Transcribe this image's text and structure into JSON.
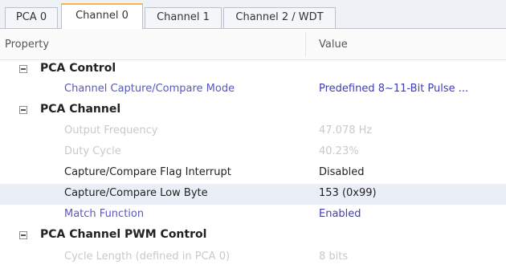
{
  "tabs": [
    "PCA 0",
    "Channel 0",
    "Channel 1",
    "Channel 2 / WDT"
  ],
  "active_tab": "Channel 0",
  "grid": {
    "headers": {
      "property": "Property",
      "value": "Value"
    },
    "categories": [
      {
        "name": "PCA Control",
        "rows": [
          {
            "property": "Channel Capture/Compare Mode",
            "value": "Predefined 8~11-Bit Pulse ...",
            "state": "blue"
          }
        ]
      },
      {
        "name": "PCA Channel",
        "rows": [
          {
            "property": "Output Frequency",
            "value": "47.078 Hz",
            "state": "disabled"
          },
          {
            "property": "Duty Cycle",
            "value": "40.23%",
            "state": "disabled"
          },
          {
            "property": "Capture/Compare Flag Interrupt",
            "value": "Disabled",
            "state": "normal"
          },
          {
            "property": "Capture/Compare Low Byte",
            "value": "153 (0x99)",
            "state": "normal-highlight"
          },
          {
            "property": "Match Function",
            "value": "Enabled",
            "state": "blue"
          }
        ]
      },
      {
        "name": "PCA Channel PWM Control",
        "rows": [
          {
            "property": "Cycle Length (defined in PCA 0)",
            "value": "8 bits",
            "state": "disabled"
          }
        ]
      }
    ]
  },
  "colors": {
    "active_tab_accent": "#f2b84b",
    "modified_text": "#3c3cc0",
    "disabled_text": "#c6c9cf",
    "highlight_row": "#e9eef7"
  },
  "icons": {
    "collapse": "minus-box-icon"
  }
}
